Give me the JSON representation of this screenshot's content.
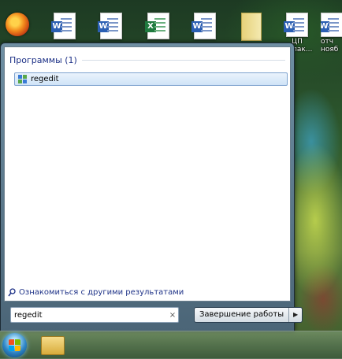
{
  "desktop": {
    "icons": [
      {
        "name": "firefox-icon",
        "caption": ""
      },
      {
        "name": "word-document-icon",
        "caption": ""
      },
      {
        "name": "word-document-icon",
        "caption": ""
      },
      {
        "name": "excel-document-icon",
        "caption": ""
      },
      {
        "name": "word-document-icon",
        "caption": ""
      },
      {
        "name": "folder-document-icon",
        "caption": ""
      },
      {
        "name": "word-document-icon",
        "caption": "ЦП\nфилак..."
      },
      {
        "name": "word-document-icon",
        "caption": "отч\nнояб"
      }
    ]
  },
  "start_menu": {
    "section_title": "Программы (1)",
    "results": [
      {
        "label": "regedit",
        "icon": "regedit-icon"
      }
    ],
    "see_more_label": "Ознакомиться с другими результатами",
    "search": {
      "value": "regedit",
      "clear_glyph": "×"
    },
    "shutdown_label": "Завершение работы",
    "shutdown_arrow": "▶"
  },
  "taskbar": {
    "start_icon": "windows-start-orb",
    "pinned": [
      {
        "icon": "folder-icon"
      }
    ]
  },
  "colors": {
    "accent_blue": "#1e3287",
    "selection_border": "#7da2ce"
  }
}
